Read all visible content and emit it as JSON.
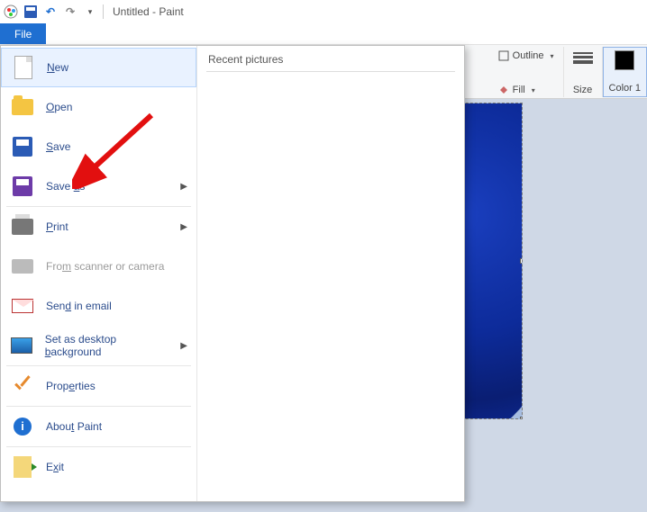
{
  "titlebar": {
    "doc_title": "Untitled - Paint",
    "qat_dropdown": "▾"
  },
  "tabs": {
    "file": "File"
  },
  "filemenu": {
    "recent_header": "Recent pictures",
    "items": {
      "new": "New",
      "open": "Open",
      "save": "Save",
      "saveas": "Save as",
      "print": "Print",
      "scanner": "From scanner or camera",
      "email": "Send in email",
      "wallpaper": "Set as desktop background",
      "properties": "Properties",
      "about": "About Paint",
      "exit": "Exit"
    }
  },
  "ribbon": {
    "outline": "Outline",
    "fill": "Fill",
    "size": "Size",
    "color1": "Color 1"
  }
}
